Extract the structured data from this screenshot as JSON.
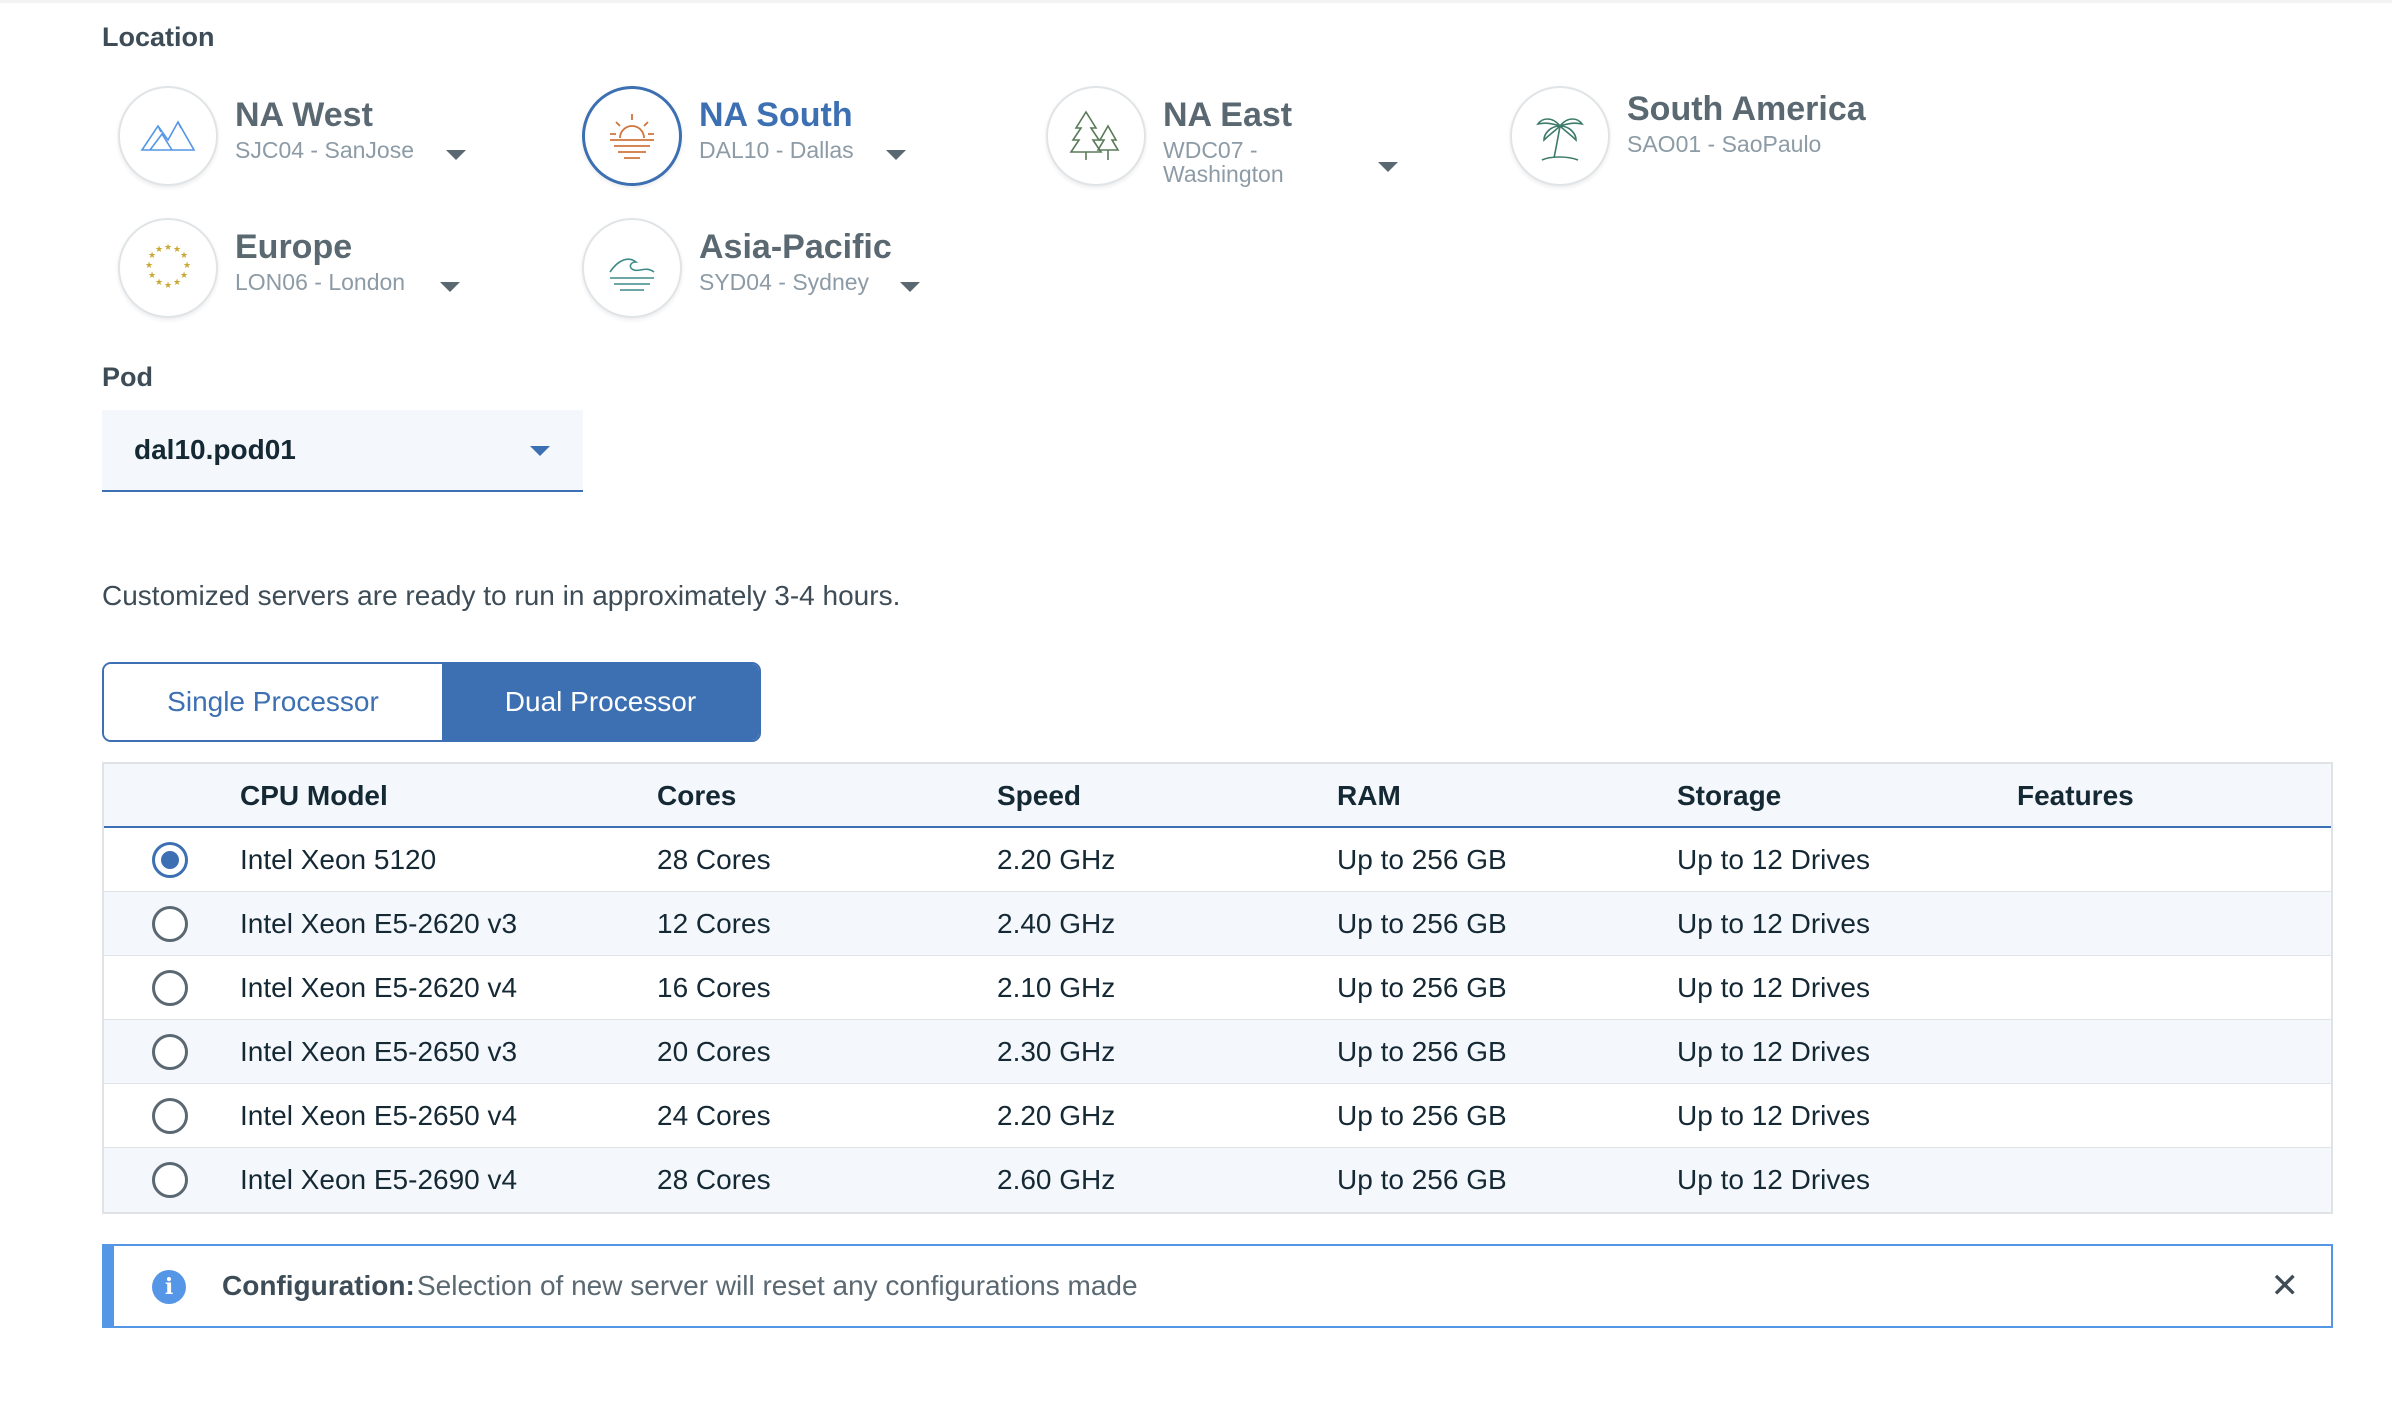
{
  "location": {
    "label": "Location",
    "items": [
      {
        "name": "NA West",
        "sub": "SJC04 - SanJose",
        "selected": false,
        "icon": "mountains-icon"
      },
      {
        "name": "NA South",
        "sub": "DAL10 - Dallas",
        "selected": true,
        "icon": "sun-icon"
      },
      {
        "name": "NA East",
        "sub": "WDC07 -\nWashington",
        "selected": false,
        "icon": "trees-icon"
      },
      {
        "name": "South America",
        "sub": "SAO01 - SaoPaulo",
        "selected": false,
        "icon": "palm-tree-icon"
      },
      {
        "name": "Europe",
        "sub": "LON06 - London",
        "selected": false,
        "icon": "eu-stars-icon"
      },
      {
        "name": "Asia-Pacific",
        "sub": "SYD04 - Sydney",
        "selected": false,
        "icon": "waves-icon"
      }
    ]
  },
  "pod": {
    "label": "Pod",
    "value": "dal10.pod01"
  },
  "ready_text": "Customized servers are ready to run in approximately 3-4 hours.",
  "processor_toggle": {
    "single": "Single Processor",
    "dual": "Dual Processor",
    "selected": "dual"
  },
  "table": {
    "headers": {
      "model": "CPU Model",
      "cores": "Cores",
      "speed": "Speed",
      "ram": "RAM",
      "storage": "Storage",
      "features": "Features"
    },
    "rows": [
      {
        "model": "Intel Xeon 5120",
        "cores": "28 Cores",
        "speed": "2.20 GHz",
        "ram": "Up to 256 GB",
        "storage": "Up to 12 Drives",
        "features": "",
        "checked": true
      },
      {
        "model": "Intel Xeon E5-2620 v3",
        "cores": "12 Cores",
        "speed": "2.40 GHz",
        "ram": "Up to 256 GB",
        "storage": "Up to 12 Drives",
        "features": "",
        "checked": false
      },
      {
        "model": "Intel Xeon E5-2620 v4",
        "cores": "16 Cores",
        "speed": "2.10 GHz",
        "ram": "Up to 256 GB",
        "storage": "Up to 12 Drives",
        "features": "",
        "checked": false
      },
      {
        "model": "Intel Xeon E5-2650 v3",
        "cores": "20 Cores",
        "speed": "2.30 GHz",
        "ram": "Up to 256 GB",
        "storage": "Up to 12 Drives",
        "features": "",
        "checked": false
      },
      {
        "model": "Intel Xeon E5-2650 v4",
        "cores": "24 Cores",
        "speed": "2.20 GHz",
        "ram": "Up to 256 GB",
        "storage": "Up to 12 Drives",
        "features": "",
        "checked": false
      },
      {
        "model": "Intel Xeon E5-2690 v4",
        "cores": "28 Cores",
        "speed": "2.60 GHz",
        "ram": "Up to 256 GB",
        "storage": "Up to 12 Drives",
        "features": "",
        "checked": false
      }
    ]
  },
  "notification": {
    "title": "Configuration:",
    "message": "Selection of new server will reset any configurations made",
    "icon": "info-icon",
    "close_glyph": "✕"
  },
  "colors": {
    "accent": "#3d70b2",
    "info": "#5596e6",
    "text": "#152935",
    "muted": "#8c9ba5"
  }
}
